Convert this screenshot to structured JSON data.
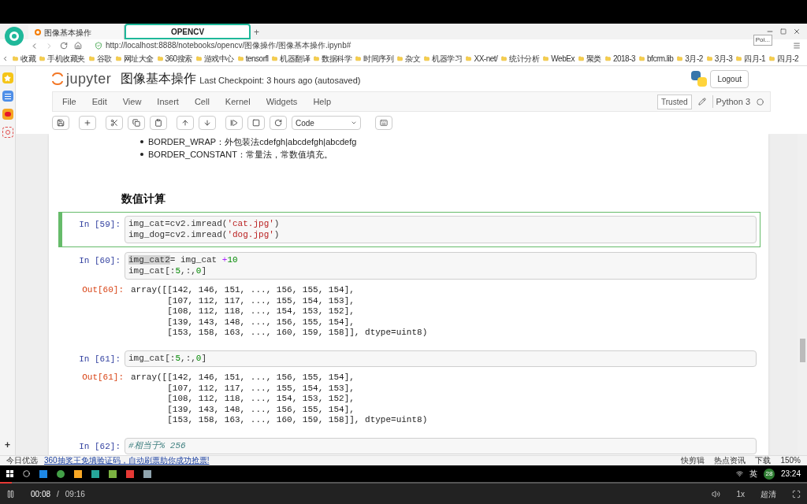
{
  "browser": {
    "tabs": [
      {
        "label": "图像基本操作",
        "selected": false
      },
      {
        "label": "OPENCV",
        "selected": true
      }
    ],
    "new_tab": "+",
    "url": "http://localhost:8888/notebooks/opencv/图像操作/图像基本操作.ipynb#",
    "tooltip": "Poi...",
    "bookmarks": [
      "收藏",
      "手机收藏夹",
      "谷歌",
      "网址大全",
      "360搜索",
      "游戏中心",
      "tensorfl",
      "机器翻译",
      "数据科学",
      "时间序列",
      "杂文",
      "机器学习",
      "XX-net/",
      "统计分析",
      "WebEx",
      "聚类",
      "2018-3",
      "bfcrm.lib",
      "3月-2",
      "3月-3",
      "四月-1",
      "四月-2"
    ],
    "sidebar_add": "+"
  },
  "jupyter": {
    "logo": "jupyter",
    "title": "图像基本操作",
    "checkpoint": "Last Checkpoint: 3 hours ago (autosaved)",
    "logout": "Logout",
    "menu": [
      "File",
      "Edit",
      "View",
      "Insert",
      "Cell",
      "Kernel",
      "Widgets",
      "Help"
    ],
    "trusted": "Trusted",
    "kernel": "Python 3",
    "cell_type": "Code"
  },
  "notebook": {
    "bullets": [
      "BORDER_WRAP：外包装法cdefgh|abcdefgh|abcdefg",
      "BORDER_CONSTANT：常量法，常数值填充。"
    ],
    "heading": "数值计算",
    "cells": [
      {
        "kind": "input",
        "prompt": "In [59]:",
        "selected": true,
        "lines": [
          [
            {
              "t": "img_cat=cv2.imread(",
              "kind": "plain"
            },
            {
              "t": "'cat.jpg'",
              "kind": "string"
            },
            {
              "t": ")",
              "kind": "plain"
            }
          ],
          [
            {
              "t": "img_dog=cv2.imread(",
              "kind": "plain"
            },
            {
              "t": "'dog.jpg'",
              "kind": "string"
            },
            {
              "t": ")",
              "kind": "plain"
            }
          ]
        ]
      },
      {
        "kind": "input",
        "prompt": "In [60]:",
        "selected": false,
        "lines": [
          [
            {
              "t": "img_cat2",
              "kind": "plain",
              "highlighted": true
            },
            {
              "t": "= img_cat ",
              "kind": "plain"
            },
            {
              "t": "+",
              "kind": "op"
            },
            {
              "t": "10",
              "kind": "number"
            }
          ],
          [
            {
              "t": "img_cat[:",
              "kind": "plain"
            },
            {
              "t": "5",
              "kind": "number"
            },
            {
              "t": ",:,",
              "kind": "plain"
            },
            {
              "t": "0",
              "kind": "number"
            },
            {
              "t": "]",
              "kind": "plain"
            }
          ]
        ]
      },
      {
        "kind": "output",
        "prompt": "Out[60]:",
        "text": [
          "array([[142, 146, 151, ..., 156, 155, 154],",
          "       [107, 112, 117, ..., 155, 154, 153],",
          "       [108, 112, 118, ..., 154, 153, 152],",
          "       [139, 143, 148, ..., 156, 155, 154],",
          "       [153, 158, 163, ..., 160, 159, 158]], dtype=uint8)"
        ]
      },
      {
        "kind": "input",
        "prompt": "In [61]:",
        "selected": false,
        "lines": [
          [
            {
              "t": "img_cat[:",
              "kind": "plain"
            },
            {
              "t": "5",
              "kind": "number"
            },
            {
              "t": ",:,",
              "kind": "plain"
            },
            {
              "t": "0",
              "kind": "number"
            },
            {
              "t": "]",
              "kind": "plain"
            }
          ]
        ]
      },
      {
        "kind": "output",
        "prompt": "Out[61]:",
        "text": [
          "array([[142, 146, 151, ..., 156, 155, 154],",
          "       [107, 112, 117, ..., 155, 154, 153],",
          "       [108, 112, 118, ..., 154, 153, 152],",
          "       [139, 143, 148, ..., 156, 155, 154],",
          "       [153, 158, 163, ..., 160, 159, 158]], dtype=uint8)"
        ]
      },
      {
        "kind": "input",
        "prompt": "In [62]:",
        "selected": false,
        "lines": [
          [
            {
              "t": "#相当于% 256",
              "kind": "comment"
            }
          ]
        ]
      }
    ]
  },
  "status_bar": {
    "left": "今日优选",
    "notice": "360抽奖王免填验证码，自动刷票助你成功抢票!",
    "right": [
      "快剪辑",
      "热点资讯",
      "下载"
    ],
    "zoom": "150%"
  },
  "taskbar": {
    "ime": "英",
    "badge": "28",
    "time": "23:24"
  },
  "player": {
    "elapsed": "00:08",
    "separator": "/",
    "duration": "09:16",
    "level": 0.015,
    "speed": "1x",
    "quality": "超清"
  }
}
